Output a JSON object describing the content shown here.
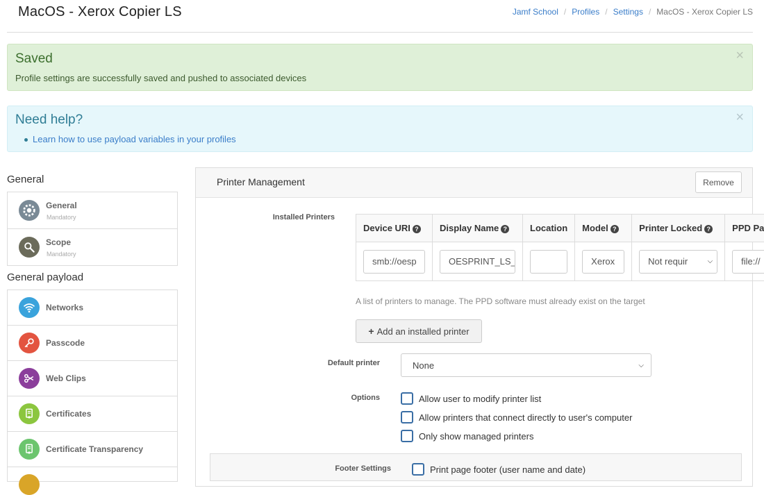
{
  "page": {
    "title": "MacOS - Xerox Copier LS"
  },
  "breadcrumb": {
    "items": [
      "Jamf School",
      "Profiles",
      "Settings"
    ],
    "current": "MacOS - Xerox Copier LS"
  },
  "alerts": {
    "success": {
      "title": "Saved",
      "text": "Profile settings are successfully saved and pushed to associated devices",
      "close": "×"
    },
    "info": {
      "title": "Need help?",
      "link": "Learn how to use payload variables in your profiles",
      "close": "×"
    }
  },
  "sidebar": {
    "general_heading": "General",
    "general_items": [
      {
        "label": "General",
        "sub": "Mandatory",
        "icon": "gear-icon"
      },
      {
        "label": "Scope",
        "sub": "Mandatory",
        "icon": "magnifier-icon"
      }
    ],
    "payload_heading": "General payload",
    "payload_items": [
      {
        "label": "Networks",
        "icon": "wifi-icon"
      },
      {
        "label": "Passcode",
        "icon": "key-icon"
      },
      {
        "label": "Web Clips",
        "icon": "scissors-icon"
      },
      {
        "label": "Certificates",
        "icon": "certificate-icon"
      },
      {
        "label": "Certificate Transparency",
        "icon": "certificate-transparency-icon"
      }
    ]
  },
  "panel": {
    "title": "Printer Management",
    "remove_label": "Remove",
    "installed_printers_label": "Installed Printers",
    "table": {
      "headers": [
        "Device URI",
        "Display Name",
        "Location",
        "Model",
        "Printer Locked",
        "PPD Pa"
      ],
      "row": {
        "device_uri": "smb://oesp",
        "display_name": "OESPRINT_LS_",
        "location": "",
        "model": "Xerox",
        "printer_locked": "Not requir",
        "ppd_path": "file://"
      }
    },
    "help_text": "A list of printers to manage. The PPD software must already exist on the target",
    "add_printer_label": "Add an installed printer",
    "default_printer_label": "Default printer",
    "default_printer_value": "None",
    "options_label": "Options",
    "options": [
      "Allow user to modify printer list",
      "Allow printers that connect directly to user's computer",
      "Only show managed printers"
    ],
    "footer_settings_label": "Footer Settings",
    "footer_option": "Print page footer (user name and date)"
  },
  "colors": {
    "success_bg": "#dff0d8",
    "info_bg": "#e6f7fb",
    "link": "#3a7dc9",
    "checkbox_border": "#3a6ea5"
  }
}
